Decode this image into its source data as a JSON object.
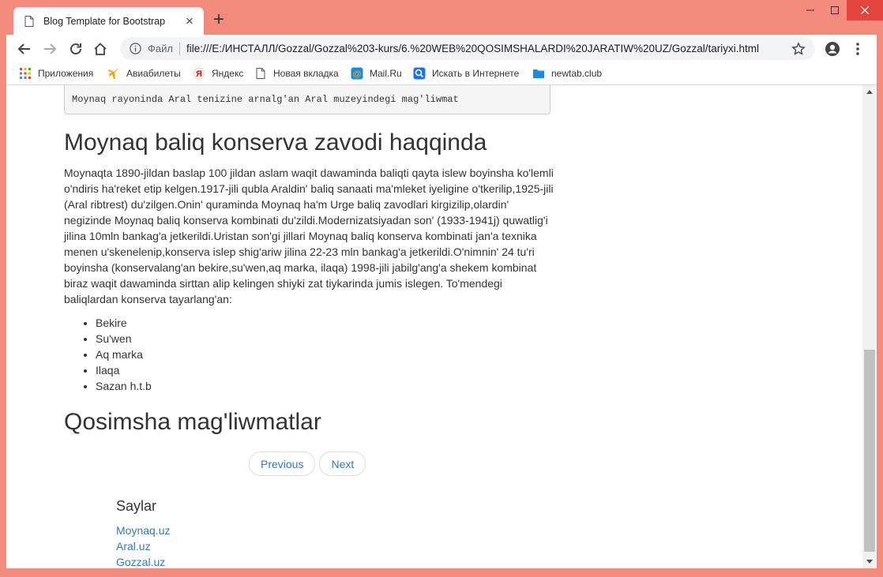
{
  "browser": {
    "tab_title": "Blog Template for Bootstrap",
    "scheme_label": "Файл",
    "url": "file:///E:/ИНСТАЛЛ/Gozzal/Gozzal%203-kurs/6.%20WEB%20QOSIMSHALARDI%20JARATIW%20UZ/Gozzal/tariyxi.html",
    "bookmarks": [
      {
        "label": "Приложения",
        "icon": "apps-grid-icon"
      },
      {
        "label": "Авиабилеты",
        "icon": "airplane-icon"
      },
      {
        "label": "Яндекс",
        "icon": "yandex-icon"
      },
      {
        "label": "Новая вкладка",
        "icon": "page-icon"
      },
      {
        "label": "Mail.Ru",
        "icon": "mailru-icon"
      },
      {
        "label": "Искать в Интернете",
        "icon": "search-icon"
      },
      {
        "label": "newtab.club",
        "icon": "folder-icon"
      }
    ]
  },
  "page": {
    "pre_text": "Moynaq rayoninda Aral tenizine arnalg'an Aral muzeyindegi mag'liwmat",
    "section1_heading": "Moynaq baliq konserva zavodi haqqinda",
    "section1_paragraph": "Moynaqta 1890-jildan baslap 100 jildan aslam waqit dawaminda baliqti qayta islew boyinsha ko'lemli o'ndiris ha'reket etip kelgen.1917-jili qubla Araldin' baliq sanaati ma'mleket iyeligine o'tkerilip,1925-jili (Aral ribtrest) du'zilgen.Onin' quraminda Moynaq ha'm Urge baliq zavodlari kirgizilip,olardin' negizinde Moynaq baliq konserva kombinati du'zildi.Modernizatsiyadan son' (1933-1941j) quwatlig'i jilina 10mln bankag'a jetkerildi.Uristan son'gi jillari Moynaq baliq konserva kombinati jan'a texnika menen u'skenelenip,konserva islep shig'ariw jilina 22-23 mln bankag'a jetkerildi.O'nimnin' 24 tu'ri boyinsha (konservalang'an bekire,su'wen,aq marka, ilaqa) 1998-jili jabilg'ang'a shekem kombinat biraz waqit dawaminda sirttan alip kelingen shiyki zat tiykarinda jumis islegen. To'mendegi baliqlardan konserva tayarlang'an:",
    "fish_list": [
      "Bekire",
      "Su'wen",
      "Aq marka",
      "Ilaqa",
      "Sazan h.t.b"
    ],
    "section2_heading": "Qosimsha mag'liwmatlar",
    "pager": {
      "previous": "Previous",
      "next": "Next"
    },
    "sites_title": "Saylar",
    "sites": [
      "Moynaq.uz",
      "Aral.uz",
      "Gozzal.uz"
    ]
  },
  "colors": {
    "window_frame": "#f28b7c",
    "link": "#337ab7",
    "close_button": "#e0443d"
  }
}
